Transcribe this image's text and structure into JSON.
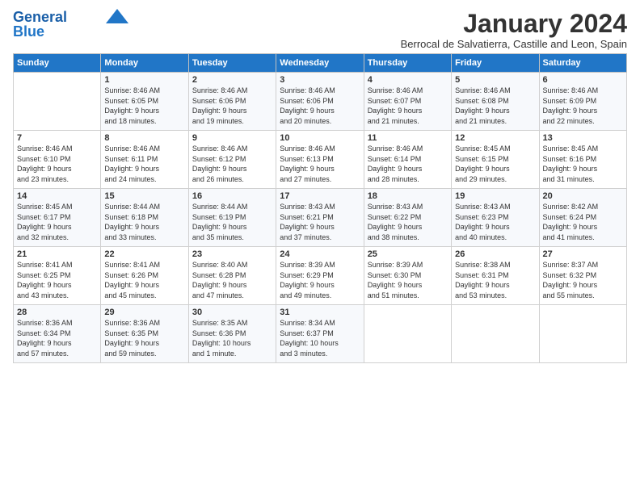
{
  "logo": {
    "line1": "General",
    "line2": "Blue"
  },
  "title": "January 2024",
  "subtitle": "Berrocal de Salvatierra, Castille and Leon, Spain",
  "days_header": [
    "Sunday",
    "Monday",
    "Tuesday",
    "Wednesday",
    "Thursday",
    "Friday",
    "Saturday"
  ],
  "weeks": [
    [
      {
        "num": "",
        "info": ""
      },
      {
        "num": "1",
        "info": "Sunrise: 8:46 AM\nSunset: 6:05 PM\nDaylight: 9 hours\nand 18 minutes."
      },
      {
        "num": "2",
        "info": "Sunrise: 8:46 AM\nSunset: 6:06 PM\nDaylight: 9 hours\nand 19 minutes."
      },
      {
        "num": "3",
        "info": "Sunrise: 8:46 AM\nSunset: 6:06 PM\nDaylight: 9 hours\nand 20 minutes."
      },
      {
        "num": "4",
        "info": "Sunrise: 8:46 AM\nSunset: 6:07 PM\nDaylight: 9 hours\nand 21 minutes."
      },
      {
        "num": "5",
        "info": "Sunrise: 8:46 AM\nSunset: 6:08 PM\nDaylight: 9 hours\nand 21 minutes."
      },
      {
        "num": "6",
        "info": "Sunrise: 8:46 AM\nSunset: 6:09 PM\nDaylight: 9 hours\nand 22 minutes."
      }
    ],
    [
      {
        "num": "7",
        "info": "Sunrise: 8:46 AM\nSunset: 6:10 PM\nDaylight: 9 hours\nand 23 minutes."
      },
      {
        "num": "8",
        "info": "Sunrise: 8:46 AM\nSunset: 6:11 PM\nDaylight: 9 hours\nand 24 minutes."
      },
      {
        "num": "9",
        "info": "Sunrise: 8:46 AM\nSunset: 6:12 PM\nDaylight: 9 hours\nand 26 minutes."
      },
      {
        "num": "10",
        "info": "Sunrise: 8:46 AM\nSunset: 6:13 PM\nDaylight: 9 hours\nand 27 minutes."
      },
      {
        "num": "11",
        "info": "Sunrise: 8:46 AM\nSunset: 6:14 PM\nDaylight: 9 hours\nand 28 minutes."
      },
      {
        "num": "12",
        "info": "Sunrise: 8:45 AM\nSunset: 6:15 PM\nDaylight: 9 hours\nand 29 minutes."
      },
      {
        "num": "13",
        "info": "Sunrise: 8:45 AM\nSunset: 6:16 PM\nDaylight: 9 hours\nand 31 minutes."
      }
    ],
    [
      {
        "num": "14",
        "info": "Sunrise: 8:45 AM\nSunset: 6:17 PM\nDaylight: 9 hours\nand 32 minutes."
      },
      {
        "num": "15",
        "info": "Sunrise: 8:44 AM\nSunset: 6:18 PM\nDaylight: 9 hours\nand 33 minutes."
      },
      {
        "num": "16",
        "info": "Sunrise: 8:44 AM\nSunset: 6:19 PM\nDaylight: 9 hours\nand 35 minutes."
      },
      {
        "num": "17",
        "info": "Sunrise: 8:43 AM\nSunset: 6:21 PM\nDaylight: 9 hours\nand 37 minutes."
      },
      {
        "num": "18",
        "info": "Sunrise: 8:43 AM\nSunset: 6:22 PM\nDaylight: 9 hours\nand 38 minutes."
      },
      {
        "num": "19",
        "info": "Sunrise: 8:43 AM\nSunset: 6:23 PM\nDaylight: 9 hours\nand 40 minutes."
      },
      {
        "num": "20",
        "info": "Sunrise: 8:42 AM\nSunset: 6:24 PM\nDaylight: 9 hours\nand 41 minutes."
      }
    ],
    [
      {
        "num": "21",
        "info": "Sunrise: 8:41 AM\nSunset: 6:25 PM\nDaylight: 9 hours\nand 43 minutes."
      },
      {
        "num": "22",
        "info": "Sunrise: 8:41 AM\nSunset: 6:26 PM\nDaylight: 9 hours\nand 45 minutes."
      },
      {
        "num": "23",
        "info": "Sunrise: 8:40 AM\nSunset: 6:28 PM\nDaylight: 9 hours\nand 47 minutes."
      },
      {
        "num": "24",
        "info": "Sunrise: 8:39 AM\nSunset: 6:29 PM\nDaylight: 9 hours\nand 49 minutes."
      },
      {
        "num": "25",
        "info": "Sunrise: 8:39 AM\nSunset: 6:30 PM\nDaylight: 9 hours\nand 51 minutes."
      },
      {
        "num": "26",
        "info": "Sunrise: 8:38 AM\nSunset: 6:31 PM\nDaylight: 9 hours\nand 53 minutes."
      },
      {
        "num": "27",
        "info": "Sunrise: 8:37 AM\nSunset: 6:32 PM\nDaylight: 9 hours\nand 55 minutes."
      }
    ],
    [
      {
        "num": "28",
        "info": "Sunrise: 8:36 AM\nSunset: 6:34 PM\nDaylight: 9 hours\nand 57 minutes."
      },
      {
        "num": "29",
        "info": "Sunrise: 8:36 AM\nSunset: 6:35 PM\nDaylight: 9 hours\nand 59 minutes."
      },
      {
        "num": "30",
        "info": "Sunrise: 8:35 AM\nSunset: 6:36 PM\nDaylight: 10 hours\nand 1 minute."
      },
      {
        "num": "31",
        "info": "Sunrise: 8:34 AM\nSunset: 6:37 PM\nDaylight: 10 hours\nand 3 minutes."
      },
      {
        "num": "",
        "info": ""
      },
      {
        "num": "",
        "info": ""
      },
      {
        "num": "",
        "info": ""
      }
    ]
  ]
}
